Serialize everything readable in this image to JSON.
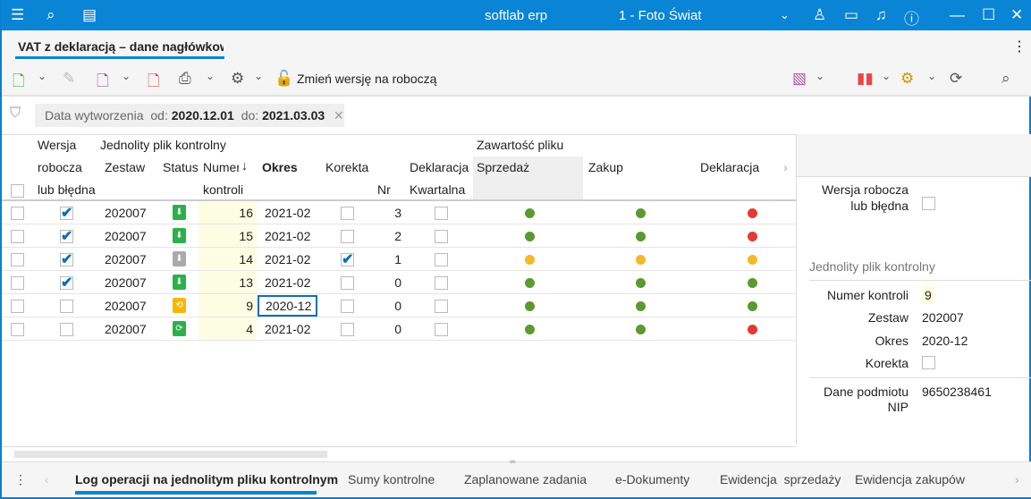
{
  "titlebar": {
    "app": "softlab erp",
    "company": "1 - Foto Świat"
  },
  "tab": {
    "label": "VAT z deklaracją – dane nagłówkowe"
  },
  "toolbar": {
    "change_version": "Zmień wersję na roboczą"
  },
  "filter": {
    "label": "Data wytworzenia",
    "from_label": "od:",
    "from": "2020.12.01",
    "to_label": "do:",
    "to": "2021.03.03"
  },
  "grid": {
    "headers": {
      "wersja1": "Wersja",
      "wersja2": "robocza",
      "wersja3": "lub błędna",
      "jpk": "Jednolity plik kontrolny",
      "zestaw": "Zestaw",
      "status": "Status",
      "numer1": "Numer",
      "numer2": "kontroli",
      "okres": "Okres",
      "korekta": "Korekta",
      "nr": "Nr",
      "dekl1": "Deklaracja",
      "dekl2": "Kwartalna",
      "zawartosc": "Zawartość pliku",
      "sprzedaz": "Sprzedaż",
      "zakup": "Zakup",
      "deklaracja": "Deklaracja"
    },
    "rows": [
      {
        "wersja": true,
        "zestaw": "202007",
        "status": "green",
        "numer": "16",
        "okres": "2021-02",
        "korekta": false,
        "nr": "3",
        "kwartalna": false,
        "dots": [
          "#5a9a2e",
          "#5a9a2e",
          "#e53935"
        ]
      },
      {
        "wersja": true,
        "zestaw": "202007",
        "status": "green",
        "numer": "15",
        "okres": "2021-02",
        "korekta": false,
        "nr": "2",
        "kwartalna": false,
        "dots": [
          "#5a9a2e",
          "#5a9a2e",
          "#e53935"
        ]
      },
      {
        "wersja": true,
        "zestaw": "202007",
        "status": "gray",
        "numer": "14",
        "okres": "2021-02",
        "korekta": true,
        "nr": "1",
        "kwartalna": false,
        "dots": [
          "#f4b82a",
          "#f4b82a",
          "#f4b82a"
        ]
      },
      {
        "wersja": true,
        "zestaw": "202007",
        "status": "green",
        "numer": "13",
        "okres": "2021-02",
        "korekta": false,
        "nr": "0",
        "kwartalna": false,
        "dots": [
          "#5a9a2e",
          "#5a9a2e",
          "#5a9a2e"
        ]
      },
      {
        "wersja": false,
        "zestaw": "202007",
        "status": "yellow",
        "numer": "9",
        "okres": "2020-12",
        "korekta": false,
        "nr": "0",
        "kwartalna": false,
        "dots": [
          "#5a9a2e",
          "#5a9a2e",
          "#5a9a2e"
        ]
      },
      {
        "wersja": false,
        "zestaw": "202007",
        "status": "green-sync",
        "numer": "4",
        "okres": "2021-02",
        "korekta": false,
        "nr": "0",
        "kwartalna": false,
        "dots": [
          "#5a9a2e",
          "#5a9a2e",
          "#e53935"
        ]
      }
    ]
  },
  "panel": {
    "wersja": "Wersja robocza lub błędna",
    "section": "Jednolity plik kontrolny",
    "numer_label": "Numer kontroli",
    "numer": "9",
    "zestaw_label": "Zestaw",
    "zestaw": "202007",
    "okres_label": "Okres",
    "okres": "2020-12",
    "korekta_label": "Korekta",
    "nip_label": "Dane podmiotu NIP",
    "nip": "9650238461"
  },
  "bottom_tabs": [
    "Log operacji na jednolitym pliku kontrolnym",
    "Sumy kontrolne",
    "Zaplanowane zadania",
    "e-Dokumenty",
    "Ewidencja  sprzedaży",
    "Ewidencja zakupów"
  ]
}
